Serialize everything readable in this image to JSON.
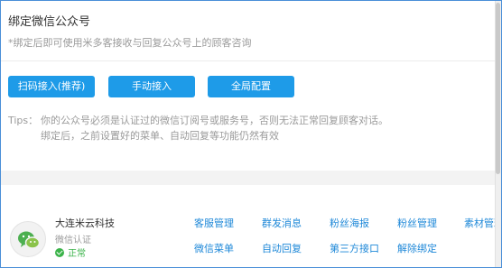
{
  "header": {
    "title": "绑定微信公众号",
    "subtitle": "*绑定后即可使用米多客接收与回复公众号上的顾客咨询"
  },
  "buttons": {
    "scan_label": "扫码接入(推荐)",
    "manual_label": "手动接入",
    "global_label": "全局配置"
  },
  "tips": {
    "label": "Tips：",
    "line1": "你的公众号必须是认证过的微信订阅号或服务号，否则无法正常回复顾客对话。",
    "line2": "绑定后，之前设置好的菜单、自动回复等功能仍然有效"
  },
  "account": {
    "name": "大连米云科技",
    "type": "微信认证",
    "status": "正常",
    "avatar_icon": "wechat-icon",
    "status_icon": "check-circle-icon",
    "links": [
      "客服管理",
      "群发消息",
      "粉丝海报",
      "粉丝管理",
      "素材管理",
      "微信菜单",
      "自动回复",
      "第三方接口",
      "解除绑定"
    ]
  },
  "colors": {
    "accent": "#1e9be8",
    "link": "#1e88d8",
    "success": "#3bb34a",
    "border": "#4a8fd8"
  }
}
